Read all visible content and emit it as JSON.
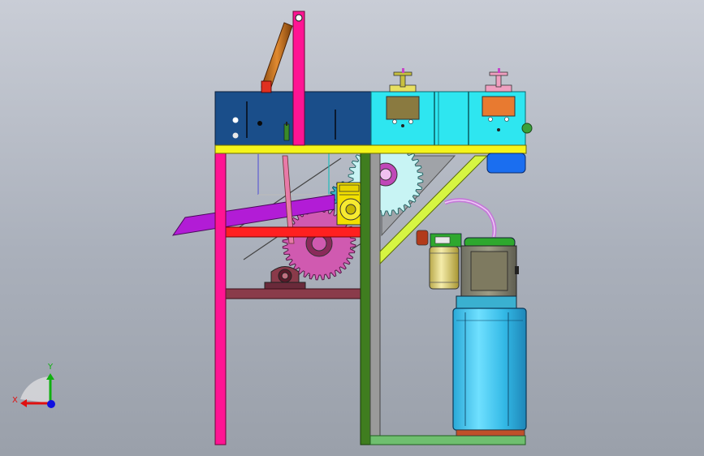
{
  "viewport": {
    "background_top": "#c9cdd6",
    "background_bottom": "#9aa0aa"
  },
  "colors": {
    "frame_magenta": "#ff1493",
    "cover_blue": "#1a4e8a",
    "cover_cyan": "#2ee6f0",
    "beam_yellow": "#f5f51a",
    "brace_yellowgreen": "#d6f542",
    "post_green": "#3f7d1f",
    "post_gray": "#9a9a9a",
    "base_green": "#6fbf6f",
    "chute_purple": "#b21cd6",
    "bar_red": "#ff2020",
    "shelf_maroon": "#8a3b4a",
    "cylinder_orange": "#c06a1a",
    "gear_pink": "#d05ab0",
    "gear_cyan": "#c8f4f4",
    "gear_teal": "#3ab6c8",
    "motor_yellow": "#f2e000",
    "tank_cyan": "#43c8ee",
    "pump_green": "#2ea82e",
    "filter_yellow": "#e8d87a",
    "hose_violet": "#c47ad8",
    "motor_blue": "#1a6ef0",
    "axis_x": "#e01010",
    "axis_y": "#10b010",
    "axis_z": "#1010e0"
  },
  "triad": {
    "x_label": "X",
    "y_label": "Y",
    "z_label": ""
  }
}
